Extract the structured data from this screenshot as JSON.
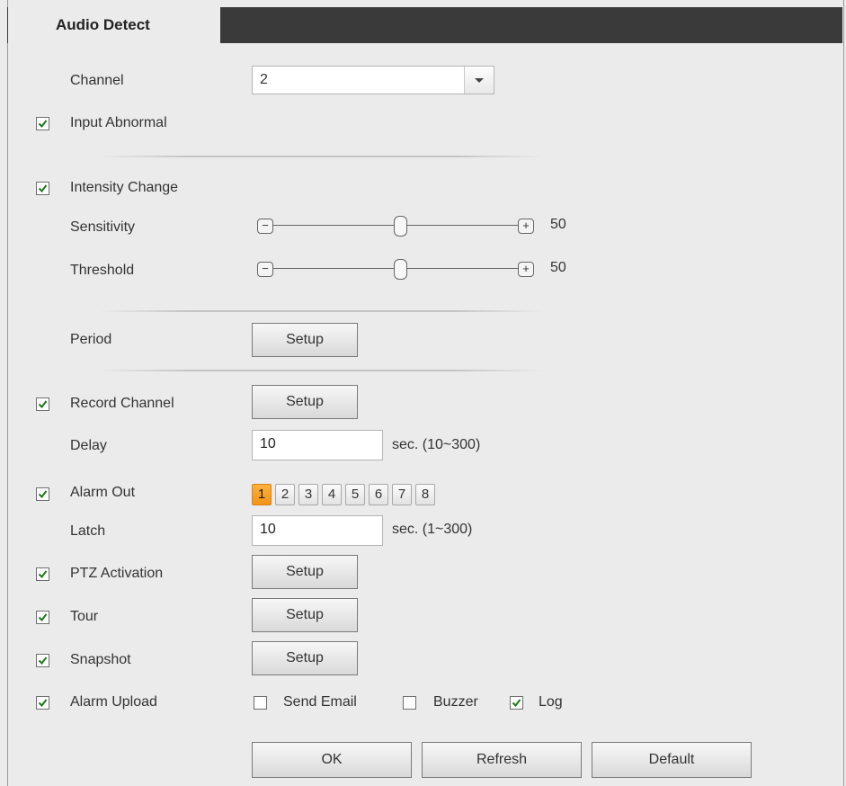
{
  "tab": {
    "title": "Audio Detect"
  },
  "channel": {
    "label": "Channel",
    "value": "2"
  },
  "input_abnormal": {
    "label": "Input Abnormal",
    "checked": true
  },
  "intensity_change": {
    "label": "Intensity Change",
    "checked": true
  },
  "sensitivity": {
    "label": "Sensitivity",
    "value": "50",
    "minus": "−",
    "plus": "+"
  },
  "threshold": {
    "label": "Threshold",
    "value": "50",
    "minus": "−",
    "plus": "+"
  },
  "period": {
    "label": "Period",
    "button": "Setup"
  },
  "record_channel": {
    "label": "Record Channel",
    "checked": true,
    "button": "Setup"
  },
  "delay": {
    "label": "Delay",
    "value": "10",
    "hint": "sec. (10~300)"
  },
  "alarm_out": {
    "label": "Alarm Out",
    "checked": true,
    "channels": [
      "1",
      "2",
      "3",
      "4",
      "5",
      "6",
      "7",
      "8"
    ],
    "active": "1"
  },
  "latch": {
    "label": "Latch",
    "value": "10",
    "hint": "sec. (1~300)"
  },
  "ptz_activation": {
    "label": "PTZ Activation",
    "checked": true,
    "button": "Setup"
  },
  "tour": {
    "label": "Tour",
    "checked": true,
    "button": "Setup"
  },
  "snapshot": {
    "label": "Snapshot",
    "checked": true,
    "button": "Setup"
  },
  "alarm_upload": {
    "label": "Alarm Upload",
    "checked": true
  },
  "send_email": {
    "label": "Send Email",
    "checked": false
  },
  "buzzer": {
    "label": "Buzzer",
    "checked": false
  },
  "log": {
    "label": "Log",
    "checked": true
  },
  "footer": {
    "ok": "OK",
    "refresh": "Refresh",
    "default": "Default"
  },
  "colors": {
    "accent": "#f5a020",
    "tabbar": "#3a3a3a",
    "check": "#1a7a1a"
  }
}
